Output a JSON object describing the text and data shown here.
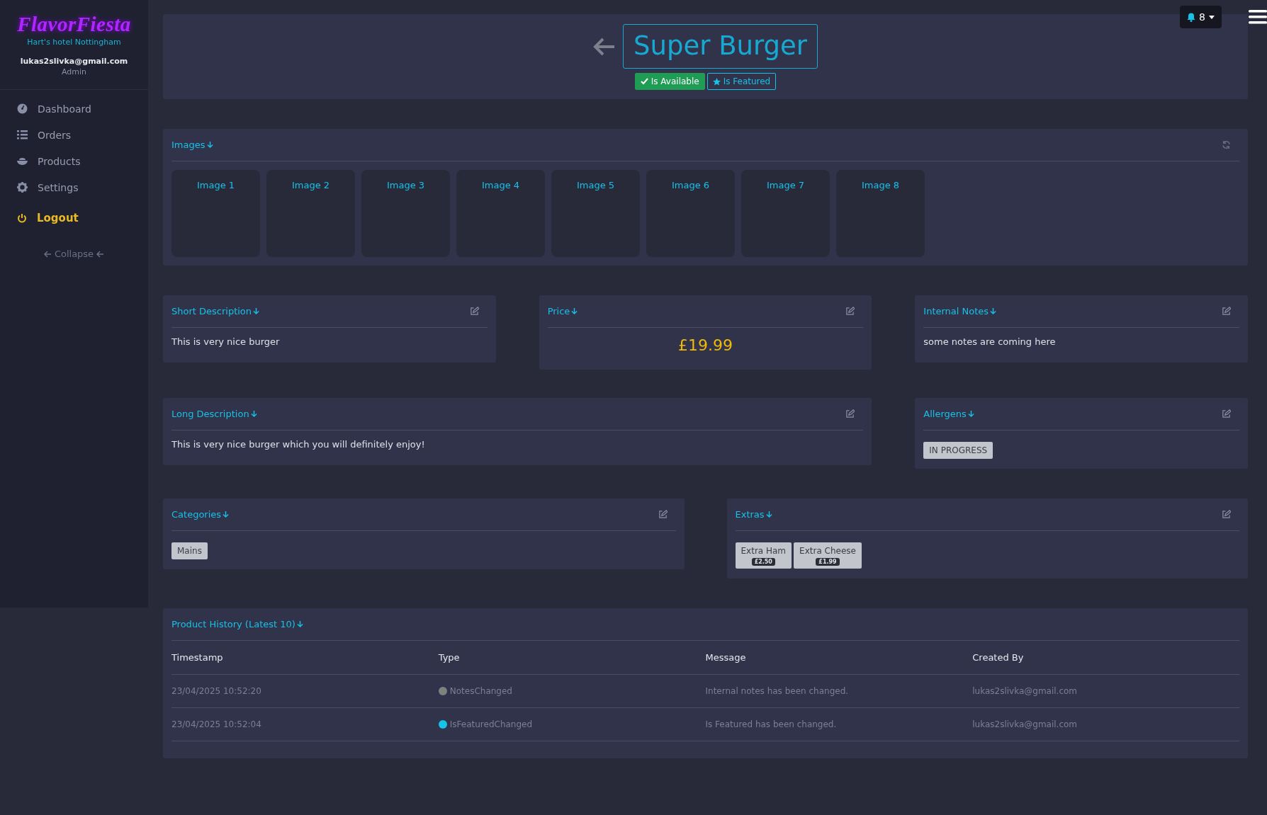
{
  "sidebar": {
    "logo": "FlavorFiesta",
    "venue": "Hart's hotel Nottingham",
    "user_email": "lukas2slivka@gmail.com",
    "user_role": "Admin",
    "items": [
      {
        "label": "Dashboard",
        "kind": "nav"
      },
      {
        "label": "Orders",
        "kind": "nav"
      },
      {
        "label": "Products",
        "kind": "nav"
      },
      {
        "label": "Settings",
        "kind": "nav"
      },
      {
        "label": "Logout",
        "kind": "logout"
      }
    ],
    "collapse": "Collapse"
  },
  "topbar": {
    "notifications": "8"
  },
  "header": {
    "title": "Super Burger",
    "badges": [
      {
        "label": "Is Available",
        "kind": "available",
        "on": true
      },
      {
        "label": "Is Featured",
        "kind": "featured",
        "on": true
      }
    ]
  },
  "images": {
    "title": "Images",
    "tiles": [
      "Image 1",
      "Image 2",
      "Image 3",
      "Image 4",
      "Image 5",
      "Image 6",
      "Image 7",
      "Image 8"
    ]
  },
  "short_description": {
    "title": "Short Description",
    "text": "This is very nice burger"
  },
  "price": {
    "title": "Price",
    "value": "£19.99"
  },
  "internal_notes": {
    "title": "Internal Notes",
    "text": "some notes are coming here"
  },
  "long_description": {
    "title": "Long Description",
    "text": "This is very nice burger which you will definitely enjoy!"
  },
  "allergens": {
    "title": "Allergens",
    "tags": [
      "IN PROGRESS"
    ]
  },
  "categories": {
    "title": "Categories",
    "tags": [
      "Mains"
    ]
  },
  "extras": {
    "title": "Extras",
    "items": [
      {
        "name": "Extra Ham",
        "price": "£2.50"
      },
      {
        "name": "Extra Cheese",
        "price": "£1.99"
      }
    ]
  },
  "history": {
    "title": "Product History (Latest 10)",
    "columns": [
      "Timestamp",
      "Type",
      "Message",
      "Created By"
    ],
    "rows": [
      {
        "timestamp": "23/04/2025 10:52:20",
        "type": "NotesChanged",
        "color": "#808080",
        "message": "Internal notes has been changed.",
        "created_by": "lukas2slivka@gmail.com"
      },
      {
        "timestamp": "23/04/2025 10:52:04",
        "type": "IsFeaturedChanged",
        "color": "#17c1e8",
        "message": "Is Featured has been changed.",
        "created_by": "lukas2slivka@gmail.com"
      }
    ]
  }
}
